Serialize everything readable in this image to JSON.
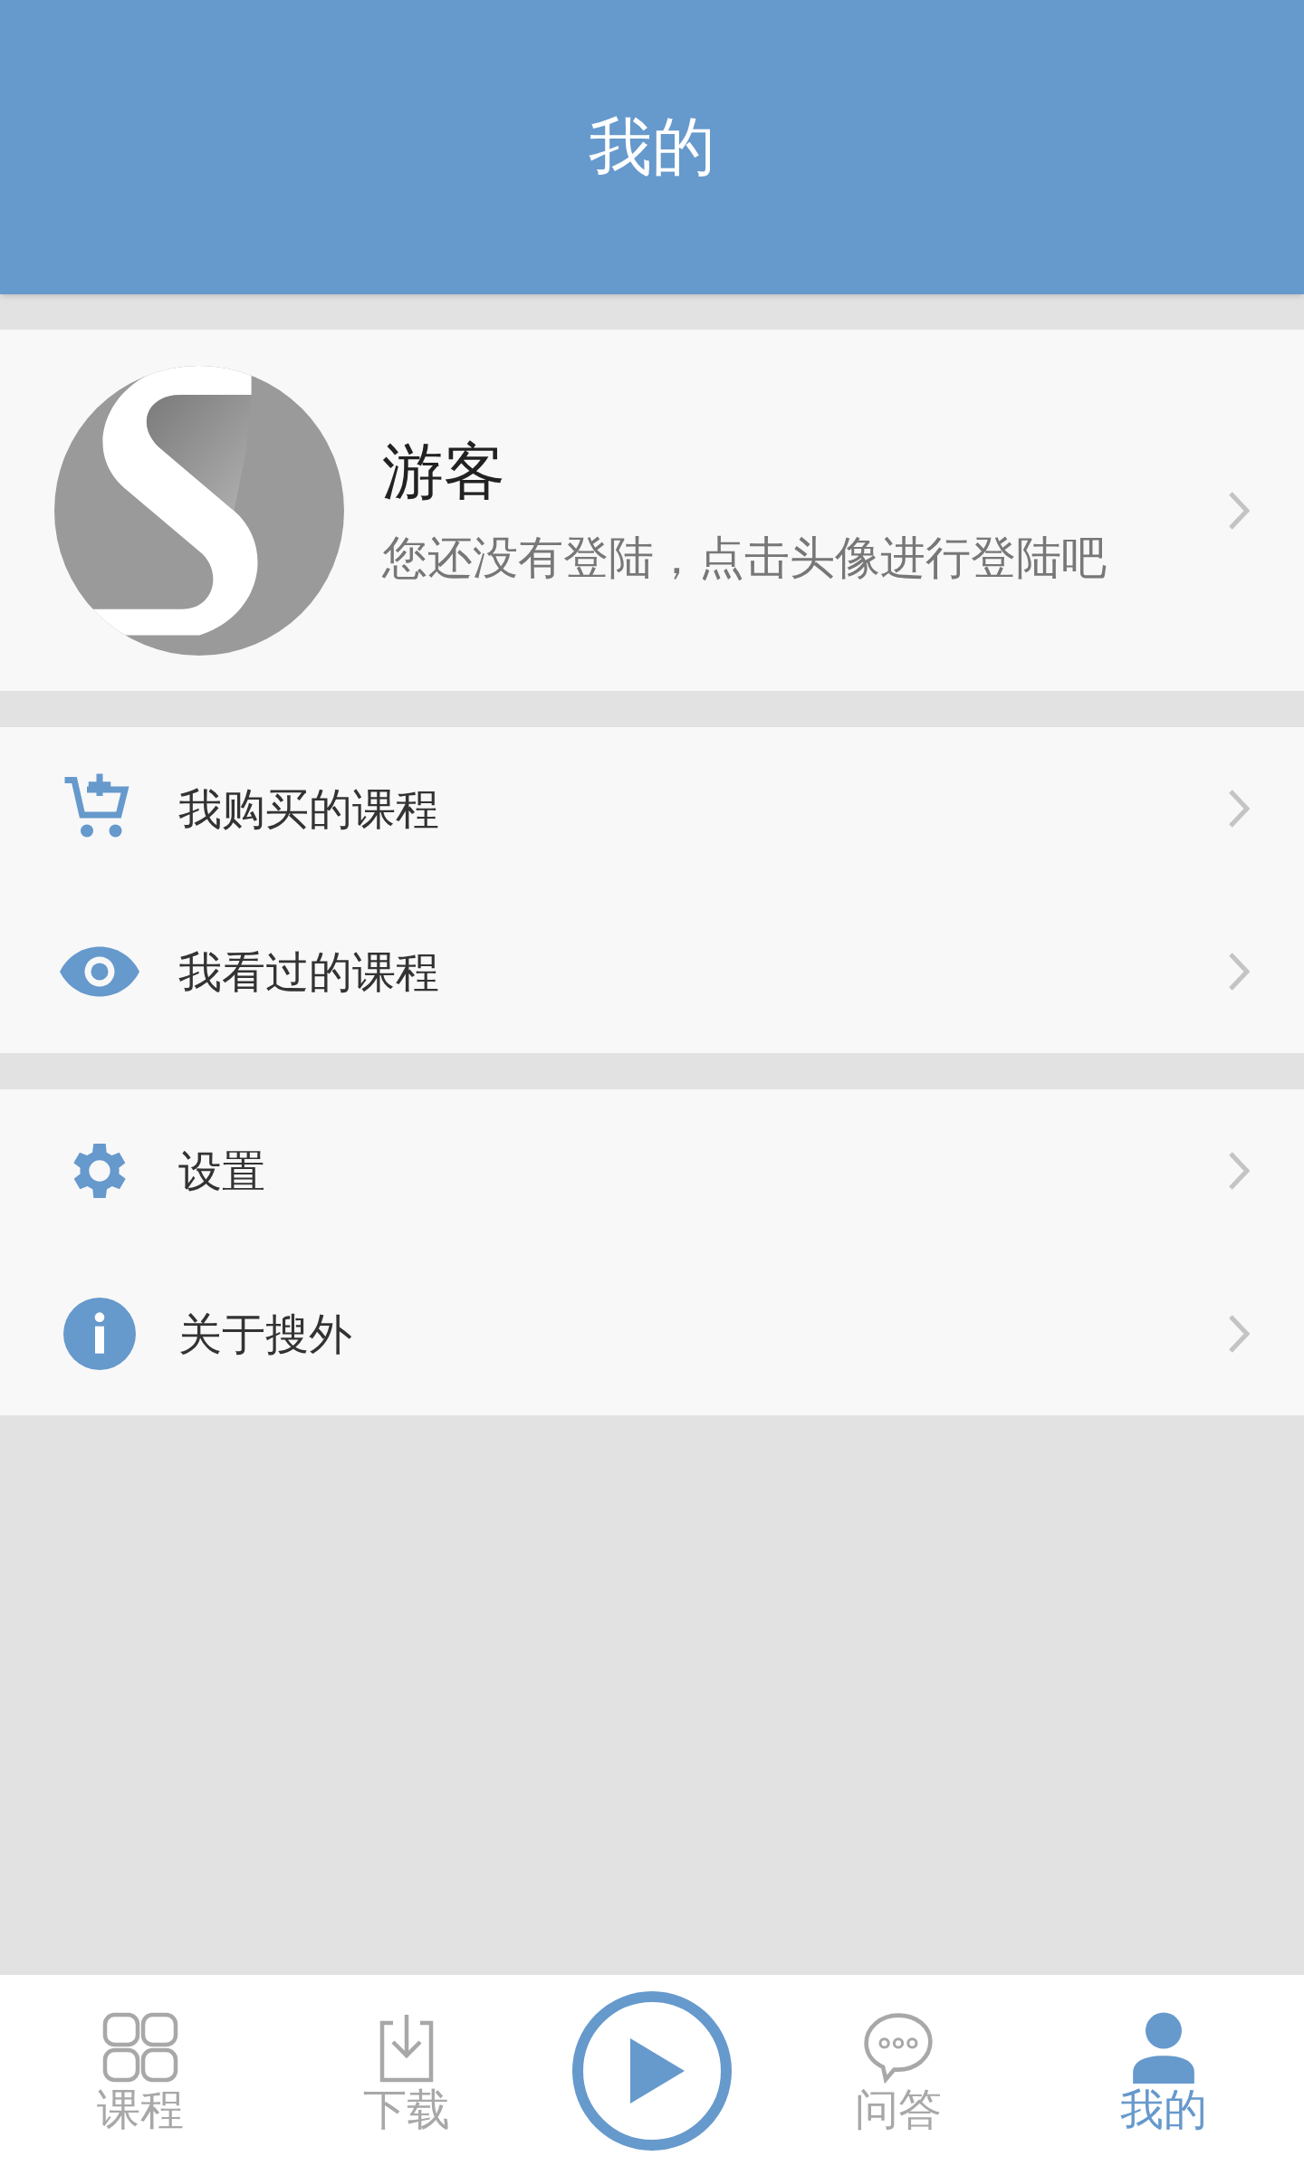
{
  "header": {
    "title": "我的"
  },
  "profile": {
    "name": "游客",
    "subtitle": "您还没有登陆，点击头像进行登陆吧"
  },
  "menu_groups": [
    [
      {
        "label": "我购买的课程"
      },
      {
        "label": "我看过的课程"
      }
    ],
    [
      {
        "label": "设置"
      },
      {
        "label": "关于搜外"
      }
    ]
  ],
  "tabs": [
    {
      "label": "课程",
      "selected": false
    },
    {
      "label": "下载",
      "selected": false
    },
    {
      "label": "问答",
      "selected": false
    },
    {
      "label": "我的",
      "selected": true
    }
  ]
}
